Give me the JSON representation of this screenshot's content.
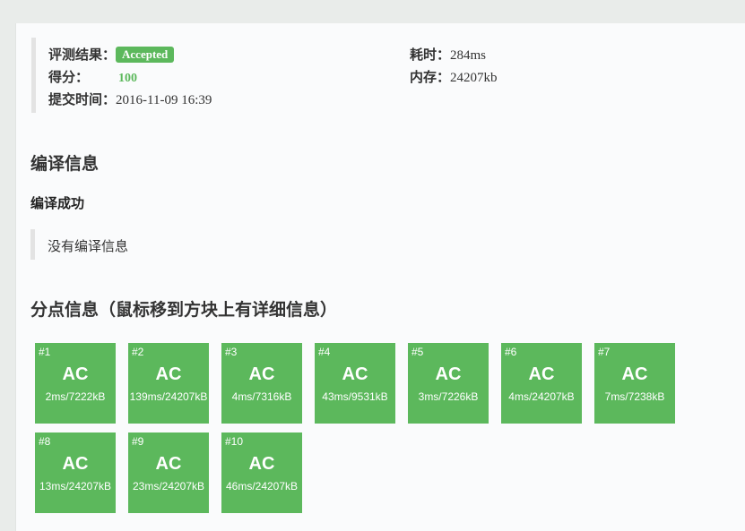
{
  "summary": {
    "result_label": "评测结果：",
    "result_value": "Accepted",
    "score_label": "得分：",
    "score_value": "100",
    "submit_time_label": "提交时间：",
    "submit_time_value": "2016-11-09 16:39",
    "time_label": "耗时：",
    "time_value": "284ms",
    "memory_label": "内存：",
    "memory_value": "24207kb"
  },
  "compile": {
    "heading": "编译信息",
    "status": "编译成功",
    "message": "没有编译信息"
  },
  "subtasks": {
    "heading": "分点信息（鼠标移到方块上有详细信息）",
    "items": [
      {
        "index": "#1",
        "result": "AC",
        "detail": "2ms/7222kB"
      },
      {
        "index": "#2",
        "result": "AC",
        "detail": "139ms/24207kB"
      },
      {
        "index": "#3",
        "result": "AC",
        "detail": "4ms/7316kB"
      },
      {
        "index": "#4",
        "result": "AC",
        "detail": "43ms/9531kB"
      },
      {
        "index": "#5",
        "result": "AC",
        "detail": "3ms/7226kB"
      },
      {
        "index": "#6",
        "result": "AC",
        "detail": "4ms/24207kB"
      },
      {
        "index": "#7",
        "result": "AC",
        "detail": "7ms/7238kB"
      },
      {
        "index": "#8",
        "result": "AC",
        "detail": "13ms/24207kB"
      },
      {
        "index": "#9",
        "result": "AC",
        "detail": "23ms/24207kB"
      },
      {
        "index": "#10",
        "result": "AC",
        "detail": "46ms/24207kB"
      }
    ]
  },
  "colors": {
    "accent": "#5cb85c",
    "background": "#e9ecea",
    "panel": "#fafbfc"
  }
}
